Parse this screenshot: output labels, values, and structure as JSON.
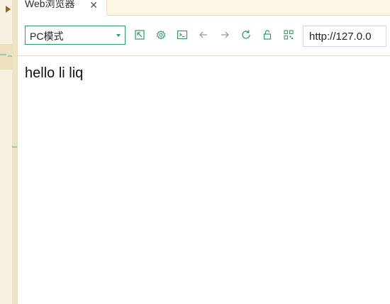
{
  "tab": {
    "title": "Web浏览器",
    "close_symbol": "✕"
  },
  "toolbar": {
    "mode_select": {
      "value": "PC模式"
    },
    "icons": [
      "open-external-icon",
      "settings-icon",
      "console-icon",
      "back-arrow-icon",
      "forward-arrow-icon",
      "refresh-icon",
      "lock-icon",
      "qr-code-icon"
    ],
    "url": "http://127.0.0",
    "accent_color": "#2e9e5b",
    "disabled_color": "#9a9a9a"
  },
  "page": {
    "text": "hello li liq"
  }
}
